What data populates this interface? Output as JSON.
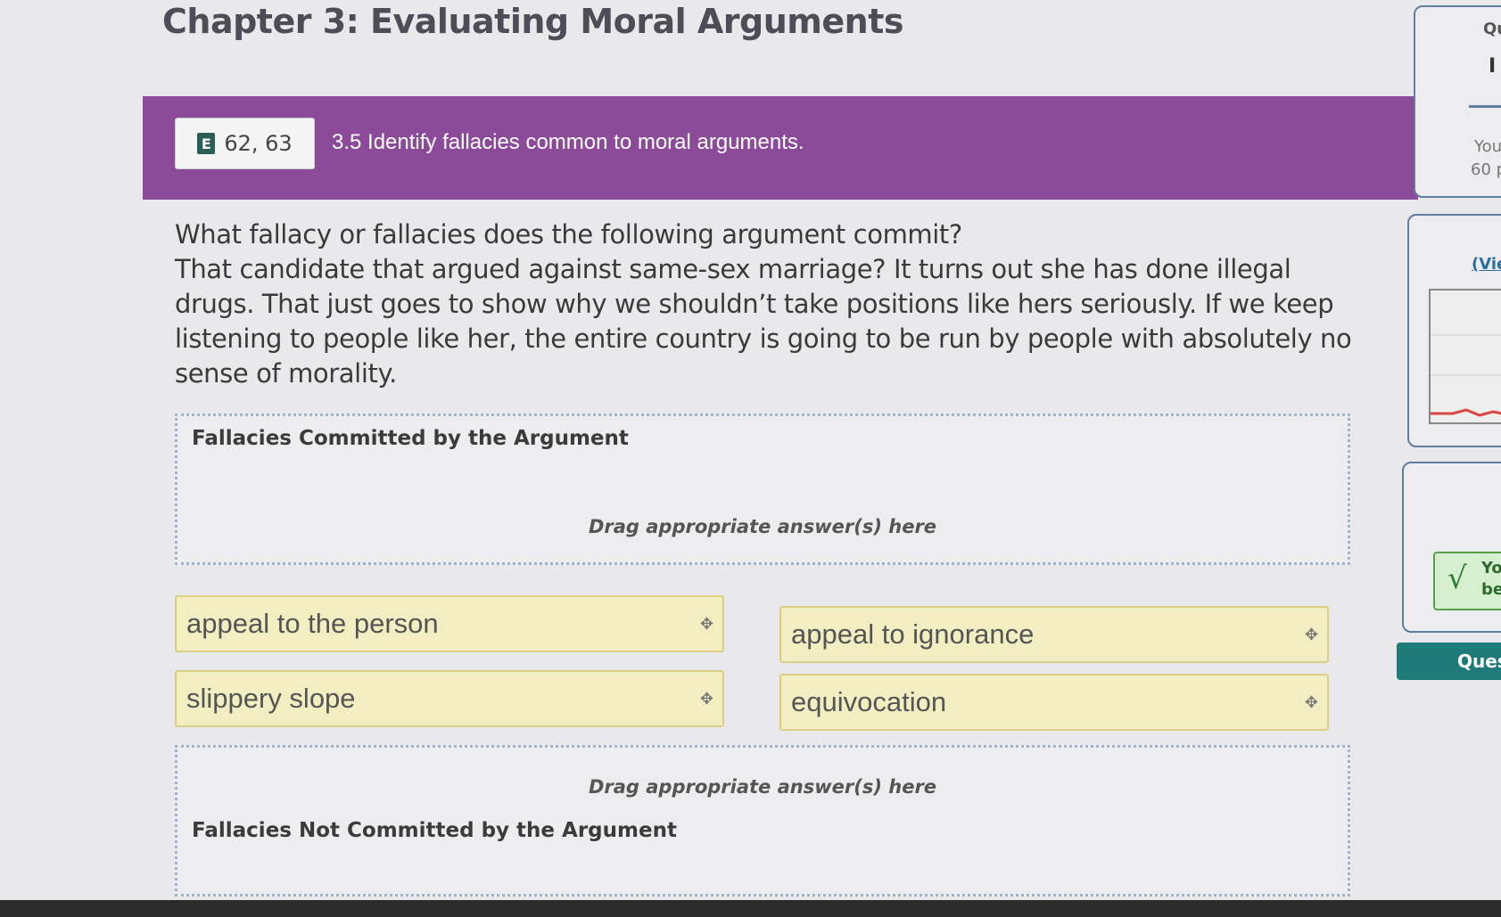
{
  "page": {
    "title": "Chapter 3: Evaluating Moral Arguments"
  },
  "banner": {
    "ebook_icon": "E",
    "ebook_pages": "62, 63",
    "objective": "3.5 Identify fallacies common to moral arguments."
  },
  "question": {
    "prompt": "What fallacy or fallacies does the following argument commit?",
    "argument": "That candidate that argued against same-sex marriage? It turns out she has done illegal drugs. That just goes to show why we shouldn’t take positions like hers seriously. If we keep listening to people like her, the entire country is going to be run by people with absolutely no sense of morality."
  },
  "zones": {
    "committed_title": "Fallacies Committed by the Argument",
    "committed_hint": "Drag appropriate answer(s) here",
    "not_committed_title": "Fallacies Not Committed by the Argument",
    "not_committed_hint": "Drag appropriate answer(s) here"
  },
  "answers": [
    "appeal to the person",
    "appeal to ignorance",
    "slippery slope",
    "equivocation"
  ],
  "move_icon": "✥",
  "sidebar": {
    "card1_top": "Qu",
    "card1_line": "I",
    "card1_you": "You",
    "card1_points": "60 p",
    "view_link": "(Vie",
    "check_mark": "√",
    "check_text_1": "Yo",
    "check_text_2": "be",
    "question_button": "Quest"
  },
  "colors": {
    "banner": "#8c4b99",
    "chip_bg": "#f2eec2",
    "teal_button": "#1f7a7a"
  }
}
